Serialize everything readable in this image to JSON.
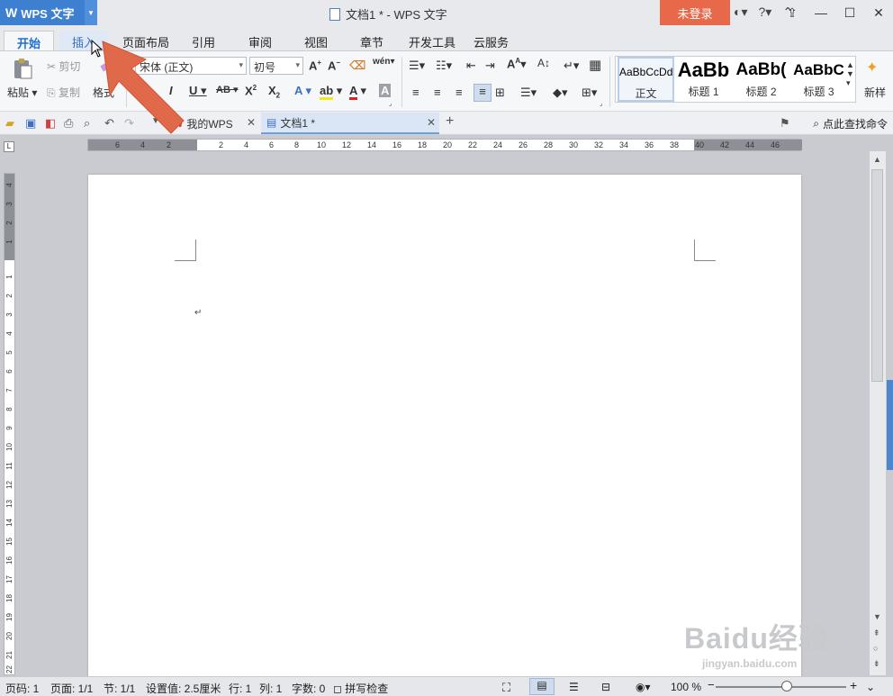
{
  "titlebar": {
    "app_name": "WPS 文字",
    "doc_title": "文档1 * - WPS 文字",
    "login_label": "未登录",
    "help_label": "?"
  },
  "tabs": [
    "开始",
    "插入",
    "页面布局",
    "引用",
    "审阅",
    "视图",
    "章节",
    "开发工具",
    "云服务"
  ],
  "ribbon": {
    "paste_label": "粘贴",
    "cut_label": "剪切",
    "copy_label": "复制",
    "format_painter_label": "格式",
    "font_name": "宋体 (正文)",
    "font_size": "初号",
    "styles": [
      {
        "preview": "AaBbCcDd",
        "label": "正文"
      },
      {
        "preview": "AaBb",
        "label": "标题 1"
      },
      {
        "preview": "AaBb(",
        "label": "标题 2"
      },
      {
        "preview": "AaBbC",
        "label": "标题 3"
      }
    ],
    "new_style_label": "新样"
  },
  "doc_tabs": {
    "home_tab": "我的WPS",
    "current_tab": "文档1 *",
    "search_cmd": "点此查找命令"
  },
  "ruler": {
    "h_ticks": [
      "6",
      "4",
      "2",
      "2",
      "4",
      "6",
      "8",
      "10",
      "12",
      "14",
      "16",
      "18",
      "20",
      "22",
      "24",
      "26",
      "28",
      "30",
      "32",
      "34",
      "36",
      "38",
      "40",
      "42",
      "44",
      "46"
    ],
    "v_ticks": [
      "4",
      "3",
      "2",
      "1",
      "1",
      "2",
      "3",
      "4",
      "5",
      "6",
      "7",
      "8",
      "9",
      "10",
      "11",
      "12",
      "13",
      "14",
      "15",
      "16",
      "17",
      "18",
      "19",
      "20",
      "21",
      "22"
    ]
  },
  "status": {
    "page_code": "页码: 1",
    "page": "页面: 1/1",
    "section": "节: 1/1",
    "setting": "设置值: 2.5厘米",
    "line": "行: 1",
    "col": "列: 1",
    "words": "字数: 0",
    "spell": "拼写检查",
    "zoom": "100 %"
  },
  "watermark": {
    "brand": "Baidu经验",
    "url": "jingyan.baidu.com"
  },
  "colors": {
    "accent": "#3d7fd1",
    "login": "#e8684a",
    "annotation_arrow": "#e0694a"
  }
}
